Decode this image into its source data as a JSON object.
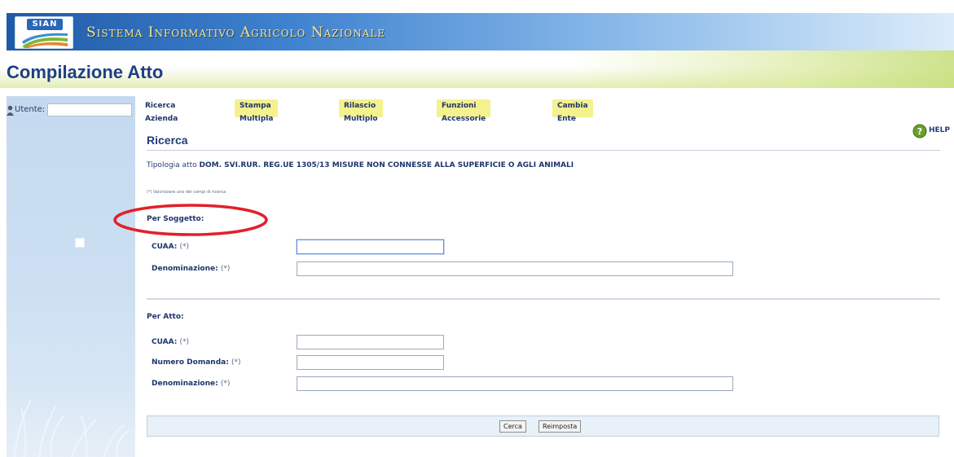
{
  "header": {
    "logo_text": "SIAN",
    "system_name": "Sistema Informativo Agricolo Nazionale",
    "page_title": "Compilazione Atto"
  },
  "sidebar": {
    "user_label": "Utente:",
    "user_value": ""
  },
  "menu": {
    "items": [
      {
        "label": "Ricerca Azienda"
      },
      {
        "label": "Stampa Multipla"
      },
      {
        "label": "Rilascio Multiplo"
      },
      {
        "label": "Funzioni Accessorie"
      },
      {
        "label": "Cambia Ente"
      }
    ]
  },
  "content": {
    "title": "Ricerca",
    "help_label": "HELP",
    "tipologia_prefix": "Tipologia atto",
    "tipologia_value": "DOM. SVI.RUR. REG.UE 1305/13 MISURE NON CONNESSE ALLA SUPERFICIE O AGLI ANIMALI",
    "note": "(*) Valorizzare uno dei campi di ricerca",
    "per_soggetto": {
      "label": "Per Soggetto:",
      "cuaa_label": "CUAA:",
      "cuaa_req": "(*)",
      "cuaa_value": "",
      "denominazione_label": "Denominazione:",
      "denominazione_req": "(*)",
      "denominazione_value": ""
    },
    "per_atto": {
      "label": "Per Atto:",
      "cuaa_label": "CUAA:",
      "cuaa_req": "(*)",
      "cuaa_value": "",
      "numero_label": "Numero Domanda:",
      "numero_req": "(*)",
      "numero_value": "",
      "denominazione_label": "Denominazione:",
      "denominazione_req": "(*)",
      "denominazione_value": ""
    },
    "buttons": {
      "cerca": "Cerca",
      "reimposta": "Reimposta"
    }
  },
  "colors": {
    "title_blue": "#1d3f86",
    "menu_highlight": "#f4f18f",
    "annotation_red": "#e2202a",
    "sidebar_blue": "#c4d9ef"
  },
  "icons": {
    "logo": "sian-logo",
    "user": "user-icon",
    "help": "help-icon"
  }
}
